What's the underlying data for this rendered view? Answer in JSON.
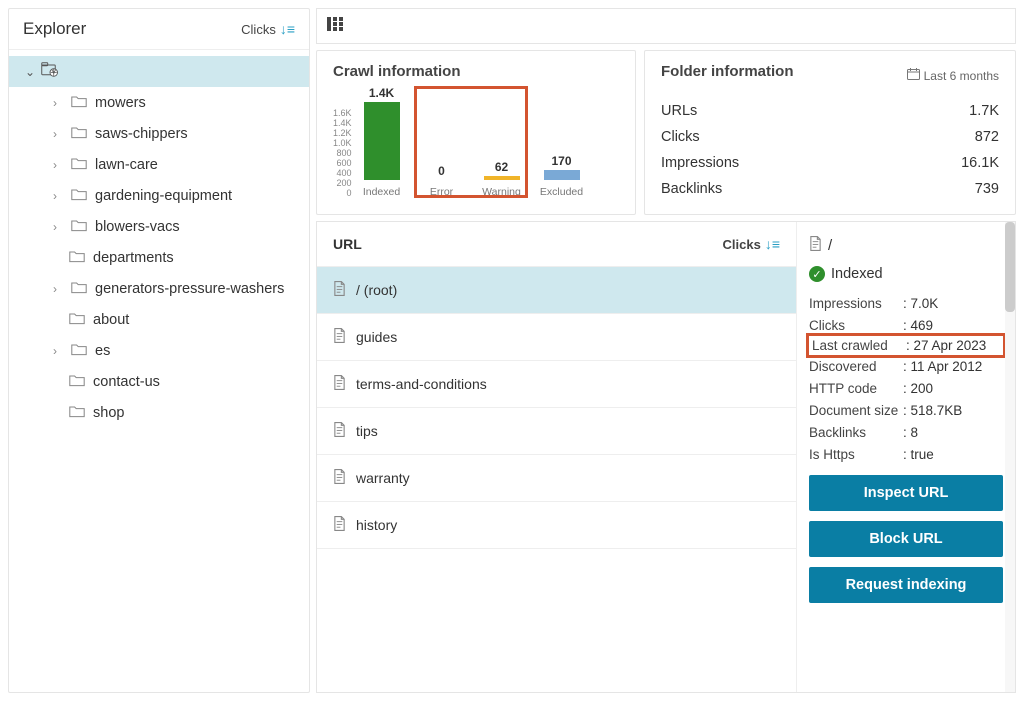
{
  "sidebar": {
    "title": "Explorer",
    "sort_label": "Clicks",
    "items": [
      {
        "label": "mowers",
        "expandable": true
      },
      {
        "label": "saws-chippers",
        "expandable": true
      },
      {
        "label": "lawn-care",
        "expandable": true
      },
      {
        "label": "gardening-equipment",
        "expandable": true
      },
      {
        "label": "blowers-vacs",
        "expandable": true
      },
      {
        "label": "departments",
        "expandable": false
      },
      {
        "label": "generators-pressure-washers",
        "expandable": true
      },
      {
        "label": "about",
        "expandable": false
      },
      {
        "label": "es",
        "expandable": true
      },
      {
        "label": "contact-us",
        "expandable": false
      },
      {
        "label": "shop",
        "expandable": false
      }
    ]
  },
  "crawl": {
    "title": "Crawl information",
    "y_ticks": [
      "1.6K",
      "1.4K",
      "1.2K",
      "1.0K",
      "800",
      "600",
      "400",
      "200",
      "0"
    ],
    "bars": {
      "indexed": {
        "value": "1.4K",
        "label": "Indexed"
      },
      "error": {
        "value": "0",
        "label": "Error"
      },
      "warning": {
        "value": "62",
        "label": "Warning"
      },
      "excluded": {
        "value": "170",
        "label": "Excluded"
      }
    }
  },
  "folder": {
    "title": "Folder information",
    "period": "Last 6 months",
    "metrics": [
      {
        "label": "URLs",
        "value": "1.7K"
      },
      {
        "label": "Clicks",
        "value": "872"
      },
      {
        "label": "Impressions",
        "value": "16.1K"
      },
      {
        "label": "Backlinks",
        "value": "739"
      }
    ]
  },
  "url_list": {
    "header": "URL",
    "sort_label": "Clicks",
    "rows": [
      {
        "label": "/ (root)",
        "selected": true
      },
      {
        "label": "guides"
      },
      {
        "label": "terms-and-conditions"
      },
      {
        "label": "tips"
      },
      {
        "label": "warranty"
      },
      {
        "label": "history"
      }
    ]
  },
  "detail": {
    "path": "/",
    "status": "Indexed",
    "kv": [
      {
        "k": "Impressions",
        "v": "7.0K"
      },
      {
        "k": "Clicks",
        "v": "469"
      },
      {
        "k": "Last crawled",
        "v": "27 Apr 2023",
        "highlight": true
      },
      {
        "k": "Discovered",
        "v": "11 Apr 2012"
      },
      {
        "k": "HTTP code",
        "v": "200"
      },
      {
        "k": "Document size",
        "v": "518.7KB",
        "tight": true
      },
      {
        "k": "Backlinks",
        "v": "8"
      },
      {
        "k": "Is Https",
        "v": "true"
      }
    ],
    "actions": {
      "inspect": "Inspect URL",
      "block": "Block URL",
      "request": "Request indexing"
    }
  },
  "chart_data": {
    "type": "bar",
    "title": "Crawl information",
    "categories": [
      "Indexed",
      "Error",
      "Warning",
      "Excluded"
    ],
    "values": [
      1400,
      0,
      62,
      170
    ],
    "ylim": [
      0,
      1600
    ],
    "y_ticks": [
      0,
      200,
      400,
      600,
      800,
      1000,
      1200,
      1400,
      1600
    ],
    "colors": [
      "#2f8f2c",
      "#c0392b",
      "#f0b429",
      "#7aa9d6"
    ]
  }
}
